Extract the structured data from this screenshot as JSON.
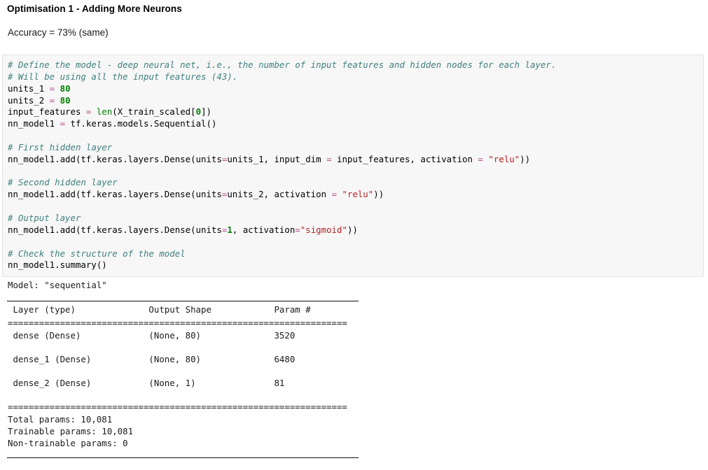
{
  "notebook": {
    "heading": "Optimisation 1 - Adding More Neurons",
    "accuracy_note": "Accuracy = 73% (same)"
  },
  "code_cell": {
    "language": "python",
    "background_color": "#f7f7f7",
    "comment_color": "#408080",
    "string_color": "#ba2121",
    "number_color": "#008000",
    "operator_color": "#b4508c",
    "lines": [
      {
        "tokens": [
          {
            "t": "# Define the model - deep neural net, i.e., the number of input features and hidden nodes for each layer.",
            "c": "c"
          }
        ]
      },
      {
        "tokens": [
          {
            "t": "# Will be using all the input features (43).",
            "c": "c"
          }
        ]
      },
      {
        "tokens": [
          {
            "t": "units_1 ",
            "c": "p"
          },
          {
            "t": "=",
            "c": "o"
          },
          {
            "t": " ",
            "c": "p"
          },
          {
            "t": "80",
            "c": "n"
          }
        ]
      },
      {
        "tokens": [
          {
            "t": "units_2 ",
            "c": "p"
          },
          {
            "t": "=",
            "c": "o"
          },
          {
            "t": " ",
            "c": "p"
          },
          {
            "t": "80",
            "c": "n"
          }
        ]
      },
      {
        "tokens": [
          {
            "t": "input_features ",
            "c": "p"
          },
          {
            "t": "=",
            "c": "o"
          },
          {
            "t": " ",
            "c": "p"
          },
          {
            "t": "len",
            "c": "nb"
          },
          {
            "t": "(X_train_scaled[",
            "c": "p"
          },
          {
            "t": "0",
            "c": "n"
          },
          {
            "t": "])",
            "c": "p"
          }
        ]
      },
      {
        "tokens": [
          {
            "t": "nn_model1 ",
            "c": "p"
          },
          {
            "t": "=",
            "c": "o"
          },
          {
            "t": " tf.keras.models.Sequential()",
            "c": "p"
          }
        ]
      },
      {
        "tokens": []
      },
      {
        "tokens": [
          {
            "t": "# First hidden layer",
            "c": "c"
          }
        ]
      },
      {
        "tokens": [
          {
            "t": "nn_model1.add(tf.keras.layers.Dense(units",
            "c": "p"
          },
          {
            "t": "=",
            "c": "o"
          },
          {
            "t": "units_1, input_dim ",
            "c": "p"
          },
          {
            "t": "=",
            "c": "o"
          },
          {
            "t": " input_features, activation ",
            "c": "p"
          },
          {
            "t": "=",
            "c": "o"
          },
          {
            "t": " ",
            "c": "p"
          },
          {
            "t": "\"relu\"",
            "c": "s"
          },
          {
            "t": "))",
            "c": "p"
          }
        ]
      },
      {
        "tokens": []
      },
      {
        "tokens": [
          {
            "t": "# Second hidden layer",
            "c": "c"
          }
        ]
      },
      {
        "tokens": [
          {
            "t": "nn_model1.add(tf.keras.layers.Dense(units",
            "c": "p"
          },
          {
            "t": "=",
            "c": "o"
          },
          {
            "t": "units_2, activation ",
            "c": "p"
          },
          {
            "t": "=",
            "c": "o"
          },
          {
            "t": " ",
            "c": "p"
          },
          {
            "t": "\"relu\"",
            "c": "s"
          },
          {
            "t": "))",
            "c": "p"
          }
        ]
      },
      {
        "tokens": []
      },
      {
        "tokens": [
          {
            "t": "# Output layer",
            "c": "c"
          }
        ]
      },
      {
        "tokens": [
          {
            "t": "nn_model1.add(tf.keras.layers.Dense(units",
            "c": "p"
          },
          {
            "t": "=",
            "c": "o"
          },
          {
            "t": "1",
            "c": "n"
          },
          {
            "t": ", activation",
            "c": "p"
          },
          {
            "t": "=",
            "c": "o"
          },
          {
            "t": "\"sigmoid\"",
            "c": "s"
          },
          {
            "t": "))",
            "c": "p"
          }
        ]
      },
      {
        "tokens": []
      },
      {
        "tokens": [
          {
            "t": "# Check the structure of the model",
            "c": "c"
          }
        ]
      },
      {
        "tokens": [
          {
            "t": "nn_model1.summary()",
            "c": "p"
          }
        ]
      }
    ]
  },
  "output": {
    "model_line": "Model: \"sequential\"",
    "table": {
      "headers": [
        "Layer (type)",
        "Output Shape",
        "Param #"
      ],
      "separator": "=================================================================",
      "rows": [
        {
          "layer": "dense (Dense)",
          "output_shape": "(None, 80)",
          "param": "3520"
        },
        {
          "layer": "dense_1 (Dense)",
          "output_shape": "(None, 80)",
          "param": "6480"
        },
        {
          "layer": "dense_2 (Dense)",
          "output_shape": "(None, 1)",
          "param": "81"
        }
      ]
    },
    "totals": [
      "Total params: 10,081",
      "Trainable params: 10,081",
      "Non-trainable params: 0"
    ]
  }
}
